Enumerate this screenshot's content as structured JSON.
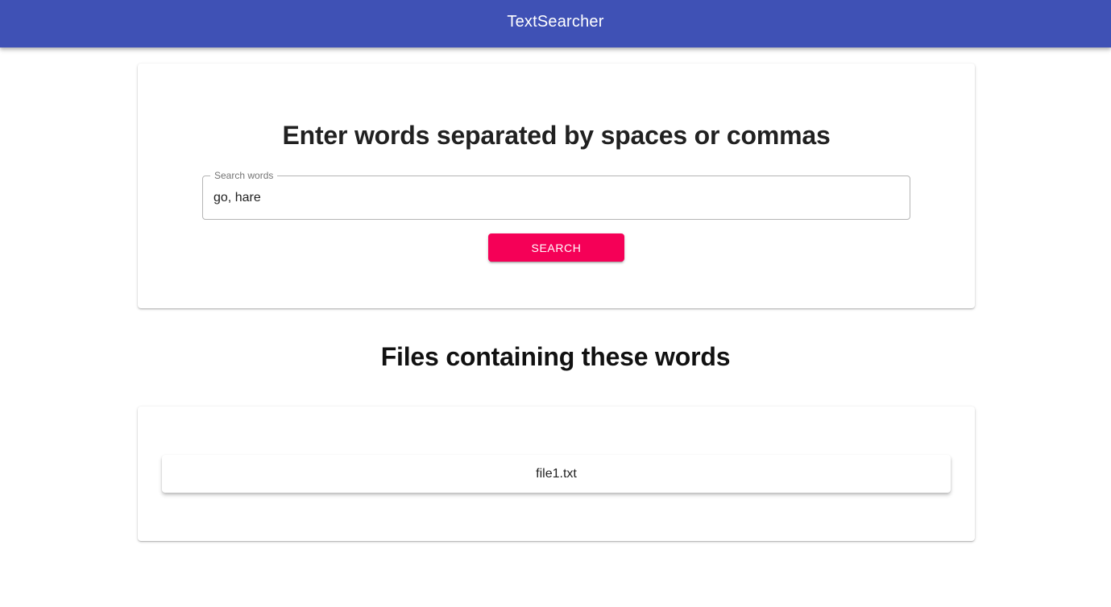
{
  "app_bar": {
    "title": "TextSearcher"
  },
  "search": {
    "heading": "Enter words separated by spaces or commas",
    "field_label": "Search words",
    "field_value": "go, hare",
    "button_label": "SEARCH"
  },
  "results": {
    "heading": "Files containing these words",
    "files": [
      "file1.txt"
    ]
  },
  "colors": {
    "app_bar": "#3f51b5",
    "accent_button": "#f50057"
  }
}
